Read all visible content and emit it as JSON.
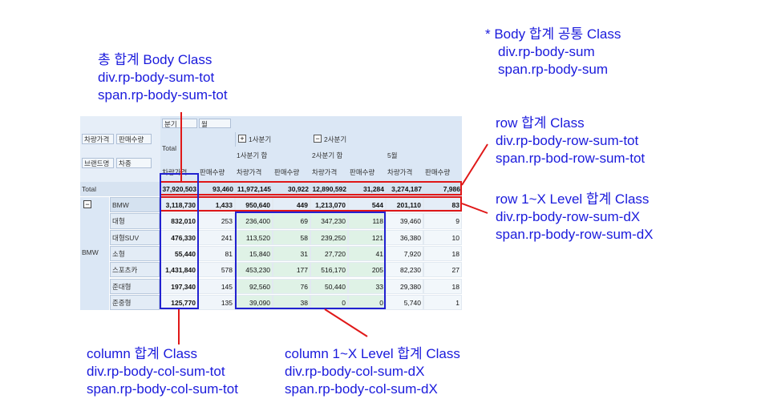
{
  "annotations": {
    "body_common": {
      "title": "* Body 합계 공통 Class",
      "line1": "div.rp-body-sum",
      "line2": "span.rp-body-sum"
    },
    "total_sum": {
      "title": "총 합계 Body Class",
      "line1": "div.rp-body-sum-tot",
      "line2": "span.rp-body-sum-tot"
    },
    "row_sum": {
      "title": "row 합계 Class",
      "line1": "div.rp-body-row-sum-tot",
      "line2": "span.rp-bod-row-sum-tot"
    },
    "row_level_sum": {
      "title": "row 1~X Level 합계 Class",
      "line1": "div.rp-body-row-sum-dX",
      "line2": "span.rp-body-row-sum-dX"
    },
    "col_sum": {
      "title": "column 합계 Class",
      "line1": "div.rp-body-col-sum-tot",
      "line2": "span.rp-body-col-sum-tot"
    },
    "col_level_sum": {
      "title": "column 1~X Level 합계 Class",
      "line1": "div.rp-body-col-sum-dX",
      "line2": "span.rp-body-col-sum-dX"
    }
  },
  "pivot": {
    "fields": {
      "quarter": "분기",
      "month": "월",
      "price": "차량가격",
      "qty": "판매수량",
      "brand": "브랜드명",
      "type": "차종"
    },
    "total_label": "Total",
    "q1_label": "1사분기",
    "q2_label": "2사분기",
    "q1_sum_label": "1사분기 합",
    "q2_sum_label": "2사분기 합",
    "month5_label": "5월",
    "measures": [
      "차량가격",
      "판매수량",
      "차량가격",
      "판매수량",
      "차량가격",
      "판매수량",
      "차량가격",
      "판매수량"
    ],
    "expand_icon_plus": "+",
    "expand_icon_minus": "−",
    "brand_group": "BMW",
    "total_row": [
      "37,920,503",
      "93,460",
      "11,972,145",
      "30,922",
      "12,890,592",
      "31,284",
      "3,274,187",
      "7,986"
    ],
    "rows": [
      {
        "label": "BMW",
        "values": [
          "3,118,730",
          "1,433",
          "950,640",
          "449",
          "1,213,070",
          "544",
          "201,110",
          "83"
        ]
      },
      {
        "label": "대형",
        "values": [
          "832,010",
          "253",
          "236,400",
          "69",
          "347,230",
          "118",
          "39,460",
          "9"
        ]
      },
      {
        "label": "대형SUV",
        "values": [
          "476,330",
          "241",
          "113,520",
          "58",
          "239,250",
          "121",
          "36,380",
          "10"
        ]
      },
      {
        "label": "소형",
        "values": [
          "55,440",
          "81",
          "15,840",
          "31",
          "27,720",
          "41",
          "7,920",
          "18"
        ]
      },
      {
        "label": "스포츠카",
        "values": [
          "1,431,840",
          "578",
          "453,230",
          "177",
          "516,170",
          "205",
          "82,230",
          "27"
        ]
      },
      {
        "label": "준대형",
        "values": [
          "197,340",
          "145",
          "92,560",
          "76",
          "50,440",
          "33",
          "29,380",
          "18"
        ]
      },
      {
        "label": "준중형",
        "values": [
          "125,770",
          "135",
          "39,090",
          "38",
          "0",
          "0",
          "5,740",
          "1"
        ]
      }
    ]
  }
}
